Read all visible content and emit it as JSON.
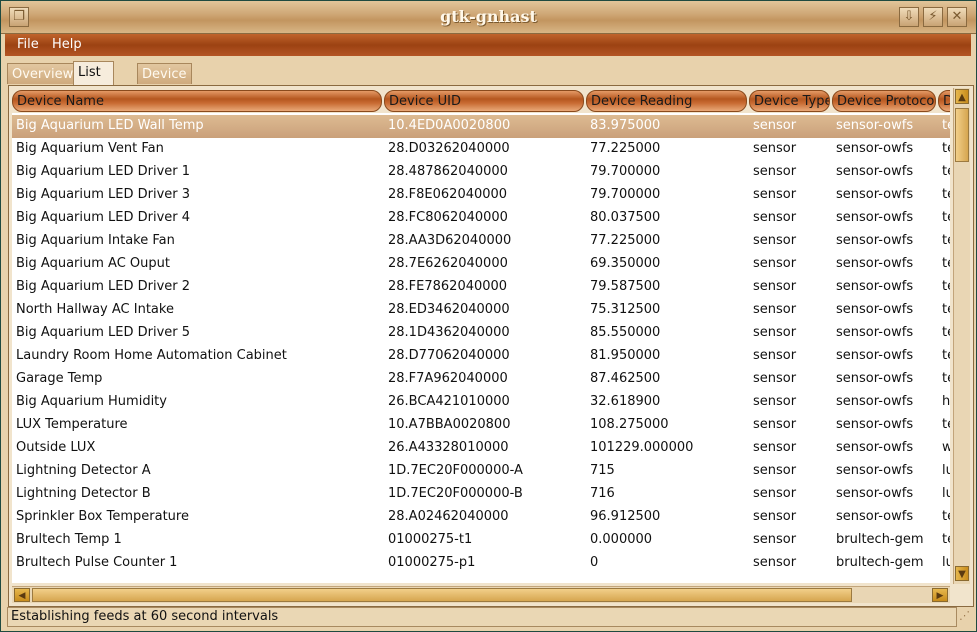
{
  "window": {
    "title": "gtk-gnhast"
  },
  "menu": {
    "file": "File",
    "help": "Help"
  },
  "tabs": [
    {
      "label": "Overview"
    },
    {
      "label": "List View"
    },
    {
      "label": "Device Details"
    }
  ],
  "columns": [
    "Device Name",
    "Device UID",
    "Device Reading",
    "Device Type",
    "Device Protocol",
    "D"
  ],
  "rows": [
    [
      "Big Aquarium LED Wall Temp",
      "10.4ED0A0020800",
      "83.975000",
      "sensor",
      "sensor-owfs",
      "te"
    ],
    [
      "Big Aquarium Vent Fan",
      "28.D03262040000",
      "77.225000",
      "sensor",
      "sensor-owfs",
      "te"
    ],
    [
      "Big Aquarium LED Driver 1",
      "28.487862040000",
      "79.700000",
      "sensor",
      "sensor-owfs",
      "te"
    ],
    [
      "Big Aquarium LED Driver 3",
      "28.F8E062040000",
      "79.700000",
      "sensor",
      "sensor-owfs",
      "te"
    ],
    [
      "Big Aquarium LED Driver 4",
      "28.FC8062040000",
      "80.037500",
      "sensor",
      "sensor-owfs",
      "te"
    ],
    [
      "Big Aquarium Intake Fan",
      "28.AA3D62040000",
      "77.225000",
      "sensor",
      "sensor-owfs",
      "te"
    ],
    [
      "Big Aquarium AC Ouput",
      "28.7E6262040000",
      "69.350000",
      "sensor",
      "sensor-owfs",
      "te"
    ],
    [
      "Big Aquarium LED Driver 2",
      "28.FE7862040000",
      "79.587500",
      "sensor",
      "sensor-owfs",
      "te"
    ],
    [
      "North Hallway AC Intake",
      "28.ED3462040000",
      "75.312500",
      "sensor",
      "sensor-owfs",
      "te"
    ],
    [
      "Big Aquarium LED Driver 5",
      "28.1D4362040000",
      "85.550000",
      "sensor",
      "sensor-owfs",
      "te"
    ],
    [
      "Laundry Room Home Automation Cabinet",
      "28.D77062040000",
      "81.950000",
      "sensor",
      "sensor-owfs",
      "te"
    ],
    [
      "Garage Temp",
      "28.F7A962040000",
      "87.462500",
      "sensor",
      "sensor-owfs",
      "te"
    ],
    [
      "Big Aquarium Humidity",
      "26.BCA421010000",
      "32.618900",
      "sensor",
      "sensor-owfs",
      "h"
    ],
    [
      "LUX Temperature",
      "10.A7BBA0020800",
      "108.275000",
      "sensor",
      "sensor-owfs",
      "te"
    ],
    [
      "Outside LUX",
      "26.A43328010000",
      "101229.000000",
      "sensor",
      "sensor-owfs",
      "w"
    ],
    [
      "Lightning Detector A",
      "1D.7EC20F000000-A",
      "715",
      "sensor",
      "sensor-owfs",
      "lu"
    ],
    [
      "Lightning Detector B",
      "1D.7EC20F000000-B",
      "716",
      "sensor",
      "sensor-owfs",
      "lu"
    ],
    [
      "Sprinkler Box Temperature",
      "28.A02462040000",
      "96.912500",
      "sensor",
      "sensor-owfs",
      "te"
    ],
    [
      "Brultech Temp 1",
      "01000275-t1",
      "0.000000",
      "sensor",
      "brultech-gem",
      "te"
    ],
    [
      "Brultech Pulse Counter 1",
      "01000275-p1",
      "0",
      "sensor",
      "brultech-gem",
      "lu"
    ]
  ],
  "status": "Establishing feeds at 60 second intervals"
}
